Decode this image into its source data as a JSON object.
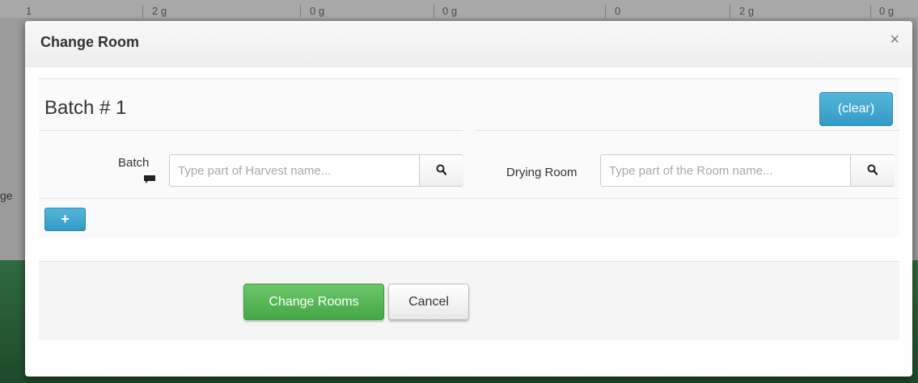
{
  "background": {
    "header_cells": [
      "1",
      "2 g",
      "0 g",
      "0 g",
      "0",
      "2 g",
      "0 g"
    ],
    "edge_text": "ge"
  },
  "modal": {
    "title": "Change Room",
    "close_icon": "×"
  },
  "batch": {
    "title": "Batch # 1",
    "clear_label": "(clear)",
    "batch_label": "Batch",
    "batch_placeholder": "Type part of Harvest name...",
    "room_label": "Drying Room",
    "room_placeholder": "Type part of the Room name...",
    "add_label": "+"
  },
  "footer": {
    "submit_label": "Change Rooms",
    "cancel_label": "Cancel"
  },
  "icons": {
    "search": "search-icon",
    "comment": "comment-icon",
    "close": "close-icon",
    "add": "plus-icon"
  },
  "colors": {
    "info_blue": "#3399c7",
    "success_green": "#45a845"
  }
}
